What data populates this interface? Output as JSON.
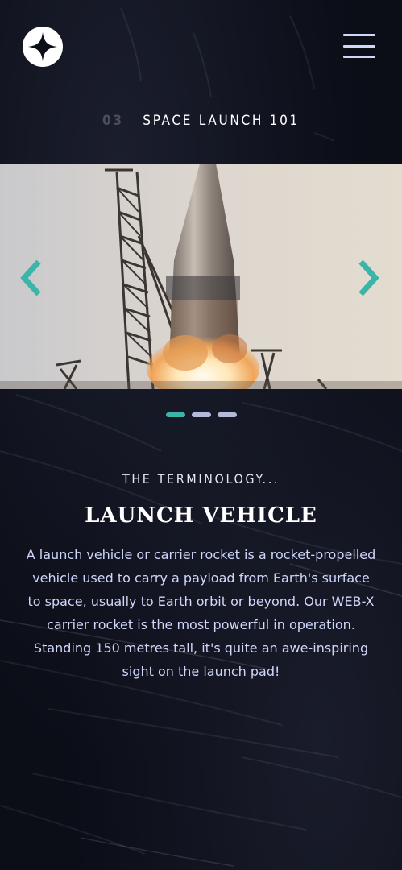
{
  "header": {
    "logo_icon": "four-point-star-icon",
    "menu_icon": "hamburger-icon"
  },
  "page_heading": {
    "number": "03",
    "title": "SPACE LAUNCH 101"
  },
  "carousel": {
    "image": "launch-vehicle-photo",
    "prev_icon": "chevron-left-icon",
    "next_icon": "chevron-right-icon",
    "accent_color": "#3ab5a8",
    "slides_total": 3,
    "active_slide": 1
  },
  "terminology": {
    "eyebrow": "THE TERMINOLOGY...",
    "title": "LAUNCH VEHICLE",
    "description": "A launch vehicle or carrier rocket is a rocket-propelled vehicle used to carry a payload from Earth's surface to space, usually to Earth orbit or beyond. Our WEB-X carrier rocket is the most powerful in operation. Standing 150 metres tall, it's quite an awe-inspiring sight on the launch pad!"
  },
  "colors": {
    "background": "#0b0d17",
    "text_light": "#d0d6f9",
    "white": "#ffffff",
    "accent": "#3ab5a8",
    "muted": "#4a4e5e"
  }
}
